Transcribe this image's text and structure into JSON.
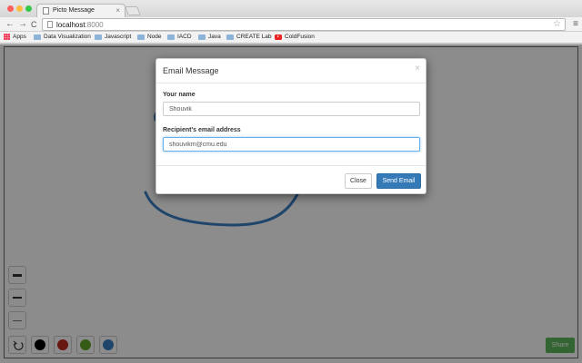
{
  "browser": {
    "tab_title": "Picto Message",
    "tab_close": "×",
    "url_host": "localhost",
    "url_port": ":8000",
    "nav": {
      "back": "←",
      "forward": "→",
      "reload": "C"
    },
    "star": "☆",
    "menu": "≡"
  },
  "bookmarks": [
    {
      "label": "Apps",
      "icon": "apps-grid-icon"
    },
    {
      "label": "Data Visualization",
      "icon": "folder-icon"
    },
    {
      "label": "Javascript",
      "icon": "folder-icon"
    },
    {
      "label": "Node",
      "icon": "folder-icon"
    },
    {
      "label": "IACD",
      "icon": "folder-icon"
    },
    {
      "label": "Java",
      "icon": "folder-icon"
    },
    {
      "label": "CREATE Lab",
      "icon": "folder-icon"
    },
    {
      "label": "ColdFusion",
      "icon": "youtube-icon"
    }
  ],
  "toolbox": {
    "stroke_sizes": [
      "thick",
      "medium",
      "thin"
    ],
    "colors": [
      "#000000",
      "#c0281e",
      "#62a82a",
      "#3a7fc4"
    ]
  },
  "share_label": "Share",
  "modal": {
    "title": "Email Message",
    "close_x": "×",
    "name_label": "Your name",
    "name_value": "Shouvik",
    "email_label": "Recipient's email address",
    "email_value": "shouvikm@cmu.edu",
    "close_label": "Close",
    "send_label": "Send Email"
  }
}
